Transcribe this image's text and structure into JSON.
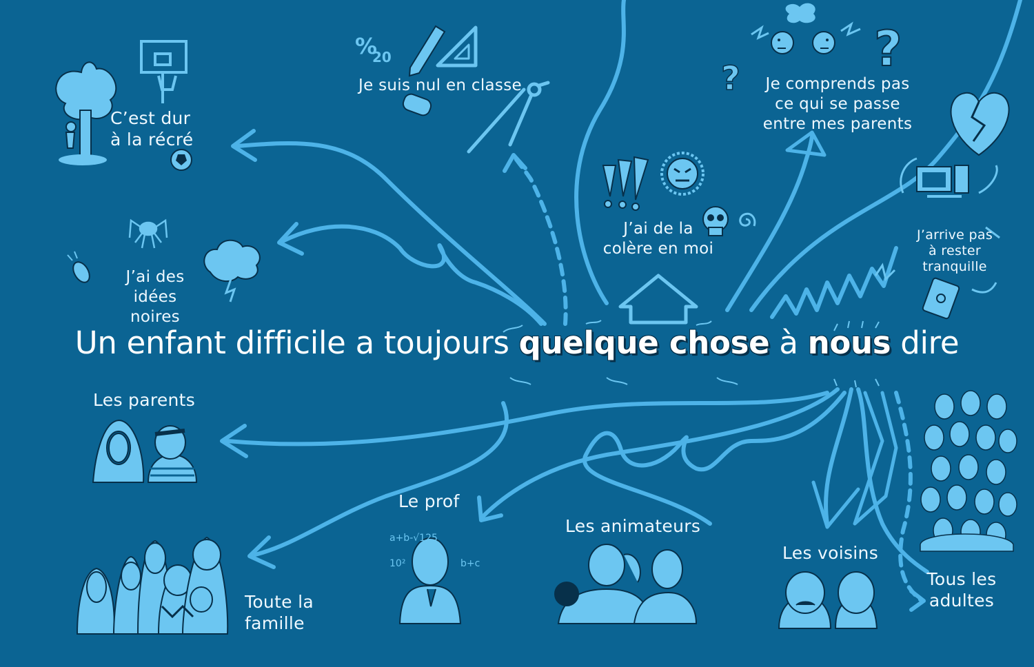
{
  "headline": {
    "part1": "Un enfant difficile a toujours ",
    "emphasis1": "quelque chose",
    "part2": " à ",
    "emphasis2": "nous",
    "part3": " dire"
  },
  "topics": {
    "recre": "C’est dur\nà la récré",
    "classe": "Je suis nul en classe",
    "parents_conflict": "Je comprends pas\nce qui se passe\nentre mes parents",
    "idees_noires": "J’ai des\nidées noires",
    "colere": "J’ai de la\ncolère en moi",
    "tranquille": "J’arrive pas\nà rester\ntranquille"
  },
  "audiences": {
    "parents": "Les parents",
    "prof": "Le prof",
    "famille": "Toute la\nfamille",
    "animateurs": "Les animateurs",
    "voisins": "Les voisins",
    "adultes": "Tous les\nadultes"
  },
  "icon_labels": {
    "grade": "%\n20"
  },
  "colors": {
    "background": "#0b6493",
    "line": "#4db3e8",
    "figure_fill": "#6cc6f1",
    "ink": "#eef8ff",
    "outline": "#07304a"
  },
  "icons": [
    "tree-icon",
    "basketball-hoop-icon",
    "football-icon",
    "pencil-icon",
    "set-square-icon",
    "compass-tool-icon",
    "eraser-icon",
    "arguing-faces-icon",
    "question-mark-icon",
    "broken-heart-icon",
    "spider-icon",
    "cockroach-icon",
    "storm-cloud-icon",
    "exclamation-marks-icon",
    "angry-face-icon",
    "skull-icon",
    "spiral-icon",
    "computer-icon",
    "phone-icon"
  ]
}
